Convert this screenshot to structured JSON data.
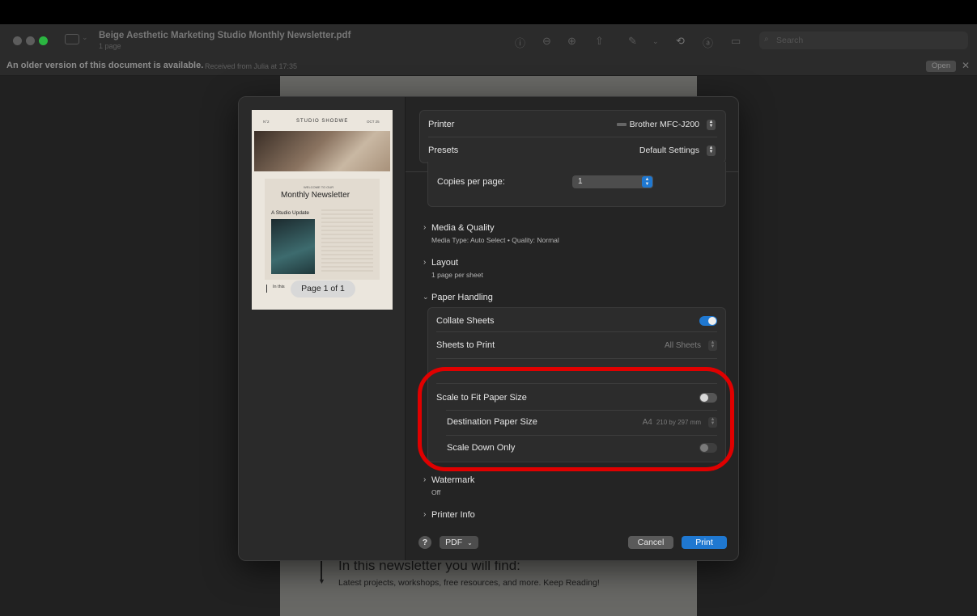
{
  "window": {
    "title": "Beige Aesthetic Marketing Studio Monthly Newsletter.pdf",
    "subtitle": "1 page",
    "search_placeholder": "Search"
  },
  "notice": {
    "message": "An older version of this document is available.",
    "detail": "Received from Julia at 17:35",
    "open_label": "Open",
    "close_glyph": "✕"
  },
  "document": {
    "heading": "In this newsletter you will find:",
    "body": "Latest projects, workshops, free resources, and more. Keep Reading!"
  },
  "preview": {
    "thumb_header_left": "N°2",
    "thumb_brand": "STUDIO SHODWE",
    "thumb_header_right": "OCT 25",
    "thumb_kicker": "WELCOME TO OUR",
    "thumb_title": "Monthly Newsletter",
    "thumb_update": "A Studio Update",
    "thumb_in_this": "In this",
    "page_pill": "Page 1 of 1"
  },
  "print": {
    "printer_label": "Printer",
    "printer_value": "Brother MFC-J200",
    "presets_label": "Presets",
    "presets_value": "Default Settings",
    "copies_per_page_label": "Copies per page:",
    "copies_per_page_value": "1",
    "media_quality_title": "Media & Quality",
    "media_quality_detail": "Media Type: Auto Select • Quality: Normal",
    "layout_title": "Layout",
    "layout_detail": "1 page per sheet",
    "paper_handling_title": "Paper Handling",
    "collate_label": "Collate Sheets",
    "collate_on": true,
    "sheets_to_print_label": "Sheets to Print",
    "sheets_to_print_value": "All Sheets",
    "scale_fit_label": "Scale to Fit Paper Size",
    "scale_fit_on": false,
    "destination_label": "Destination Paper Size",
    "destination_size": "A4",
    "destination_dims": "210 by 297 mm",
    "scale_down_label": "Scale Down Only",
    "scale_down_on": false,
    "watermark_title": "Watermark",
    "watermark_detail": "Off",
    "printer_info_title": "Printer Info",
    "help_label": "?",
    "pdf_label": "PDF",
    "cancel_label": "Cancel",
    "print_label": "Print"
  },
  "colors": {
    "accent": "#1f78d1",
    "highlight_ring": "#e00000",
    "traffic_light_green": "#2bb641"
  }
}
